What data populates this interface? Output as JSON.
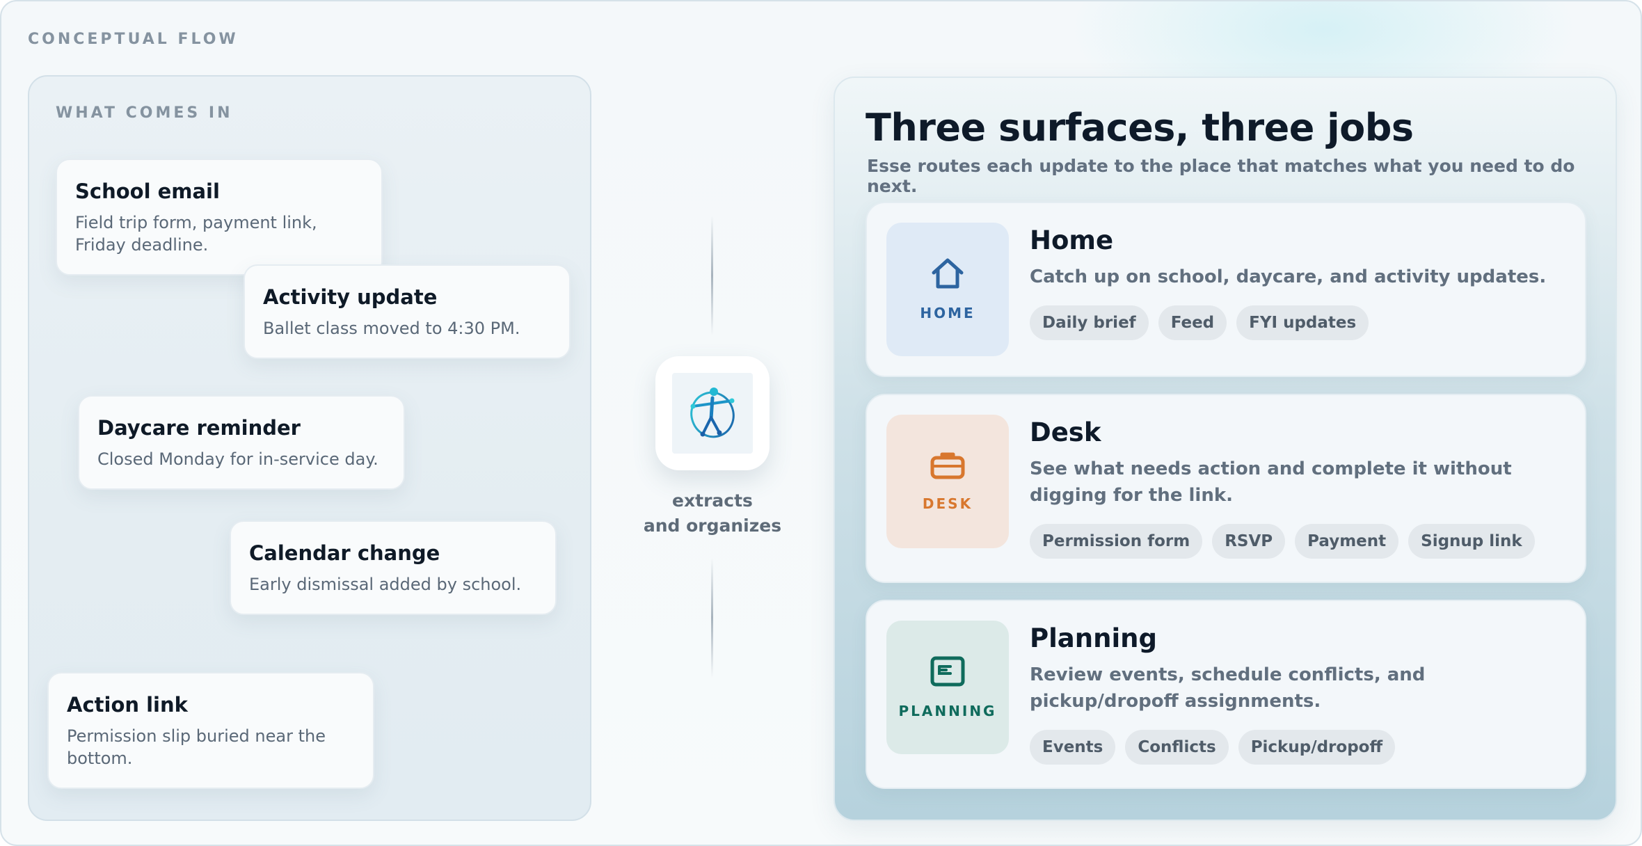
{
  "header": {
    "label": "CONCEPTUAL FLOW"
  },
  "inputs": {
    "label": "WHAT COMES IN",
    "items": [
      {
        "title": "School email",
        "body": "Field trip form, payment link, Friday deadline."
      },
      {
        "title": "Activity update",
        "body": "Ballet class moved to 4:30 PM."
      },
      {
        "title": "Daycare reminder",
        "body": "Closed Monday for in-service day."
      },
      {
        "title": "Calendar change",
        "body": "Early dismissal added by school."
      },
      {
        "title": "Action link",
        "body": "Permission slip buried near the bottom."
      }
    ]
  },
  "center": {
    "caption_line1": "extracts",
    "caption_line2": "and organizes",
    "icon": "esse-figure-logo"
  },
  "surfaces": {
    "title": "Three surfaces, three jobs",
    "subtitle": "Esse routes each update to the place that matches what you need to do next.",
    "items": [
      {
        "tile_label": "HOME",
        "icon": "home-icon",
        "title": "Home",
        "desc": "Catch up on school, daycare, and activity updates.",
        "chips": [
          "Daily brief",
          "Feed",
          "FYI updates"
        ],
        "tile_bg": "#dfeaf6",
        "accent": "#2d64a0"
      },
      {
        "tile_label": "DESK",
        "icon": "briefcase-icon",
        "title": "Desk",
        "desc": "See what needs action and complete it without digging for the link.",
        "chips": [
          "Permission form",
          "RSVP",
          "Payment",
          "Signup link"
        ],
        "tile_bg": "#f3e5dd",
        "accent": "#d8772e"
      },
      {
        "tile_label": "PLANNING",
        "icon": "calendar-icon",
        "title": "Planning",
        "desc": "Review events, schedule conflicts, and pickup/dropoff assignments.",
        "chips": [
          "Events",
          "Conflicts",
          "Pickup/dropoff"
        ],
        "tile_bg": "#dceae8",
        "accent": "#0f6b5c"
      }
    ]
  }
}
